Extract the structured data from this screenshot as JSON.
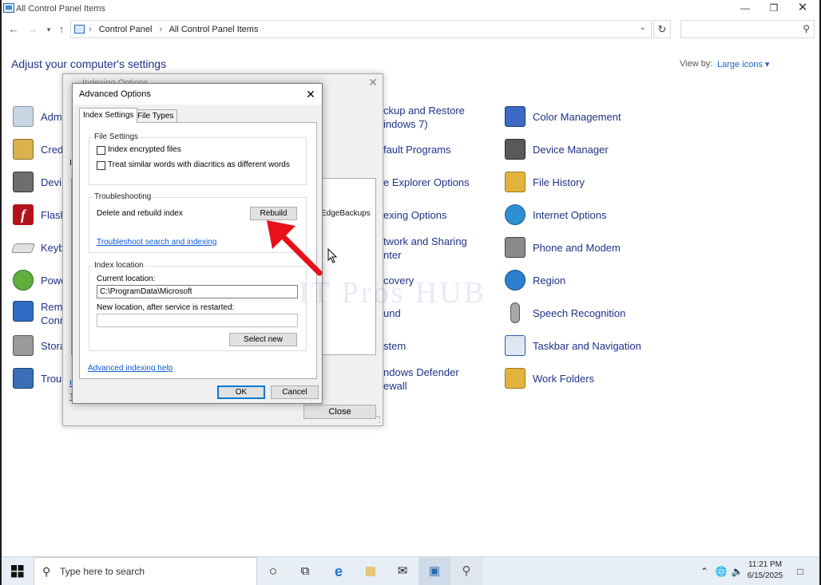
{
  "window": {
    "title": "All Control Panel Items"
  },
  "address": {
    "crumbs": [
      "Control Panel",
      "All Control Panel Items"
    ],
    "search_placeholder": ""
  },
  "content": {
    "heading": "Adjust your computer's settings",
    "view_by_label": "View by:",
    "view_by_value": "Large icons",
    "left_column": [
      {
        "label": "Adm",
        "icon": "administrative-tools-icon"
      },
      {
        "label": "Cred",
        "icon": "credential-manager-icon"
      },
      {
        "label": "Devi",
        "icon": "devices-printers-icon"
      },
      {
        "label": "Flash",
        "icon": "flash-player-icon"
      },
      {
        "label": "Keyb",
        "icon": "keyboard-icon"
      },
      {
        "label": "Powe",
        "icon": "power-options-icon"
      },
      {
        "label": "Rem",
        "label2": "Conn",
        "icon": "remoteapp-icon"
      },
      {
        "label": "Stora",
        "icon": "storage-spaces-icon"
      },
      {
        "label": "Trou",
        "icon": "troubleshooting-icon"
      }
    ],
    "middle_column": [
      {
        "label": "ckup and Restore",
        "label2": "indows 7)"
      },
      {
        "label": "fault Programs"
      },
      {
        "label": "e Explorer Options"
      },
      {
        "label": "exing Options"
      },
      {
        "label": "twork and Sharing",
        "label2": "nter"
      },
      {
        "label": "covery"
      },
      {
        "label": "und"
      },
      {
        "label": "stem"
      },
      {
        "label": "ndows Defender",
        "label2": "ewall"
      }
    ],
    "right_column": [
      {
        "label": "Color Management",
        "icon": "color-management-icon",
        "color": "#3b6bc4"
      },
      {
        "label": "Device Manager",
        "icon": "device-manager-icon",
        "color": "#5a5a5a"
      },
      {
        "label": "File History",
        "icon": "file-history-icon",
        "color": "#e2b33c"
      },
      {
        "label": "Internet Options",
        "icon": "internet-options-icon",
        "color": "#2f8fd3"
      },
      {
        "label": "Phone and Modem",
        "icon": "phone-modem-icon",
        "color": "#707070"
      },
      {
        "label": "Region",
        "icon": "region-icon",
        "color": "#2d7fd0"
      },
      {
        "label": "Speech Recognition",
        "icon": "microphone-icon",
        "color": "#8a8a8a"
      },
      {
        "label": "Taskbar and Navigation",
        "icon": "taskbar-icon",
        "color": "#2b5ea8"
      },
      {
        "label": "Work Folders",
        "icon": "work-folders-icon",
        "color": "#e2b33c"
      }
    ],
    "watermark": "IT Pros HUB"
  },
  "indexing_dialog": {
    "title": "Indexing Options",
    "list_item": "EdgeBackups",
    "close_label": "Close",
    "link_fragments": [
      "H",
      "T"
    ],
    "letter_fragment": "I"
  },
  "advanced_dialog": {
    "title": "Advanced Options",
    "tabs": [
      "Index Settings",
      "File Types"
    ],
    "file_settings": {
      "label": "File Settings",
      "option1": "Index encrypted files",
      "option2": "Treat similar words with diacritics as different words"
    },
    "troubleshooting": {
      "label": "Troubleshooting",
      "delete_label": "Delete and rebuild index",
      "rebuild_label": "Rebuild",
      "troubleshoot_link": "Troubleshoot search and indexing"
    },
    "index_location": {
      "label": "Index location",
      "current_label": "Current location:",
      "current_value": "C:\\ProgramData\\Microsoft",
      "new_label": "New location, after service is restarted:",
      "new_value": "",
      "select_new_label": "Select new"
    },
    "help_link": "Advanced indexing help",
    "ok_label": "OK",
    "cancel_label": "Cancel"
  },
  "taskbar": {
    "search_placeholder": "Type here to search",
    "time": "11:21 PM",
    "date": "6/15/2025"
  },
  "colors": {
    "accent": "#0078d7",
    "link": "#1e3287",
    "arrow": "#e8101a"
  }
}
